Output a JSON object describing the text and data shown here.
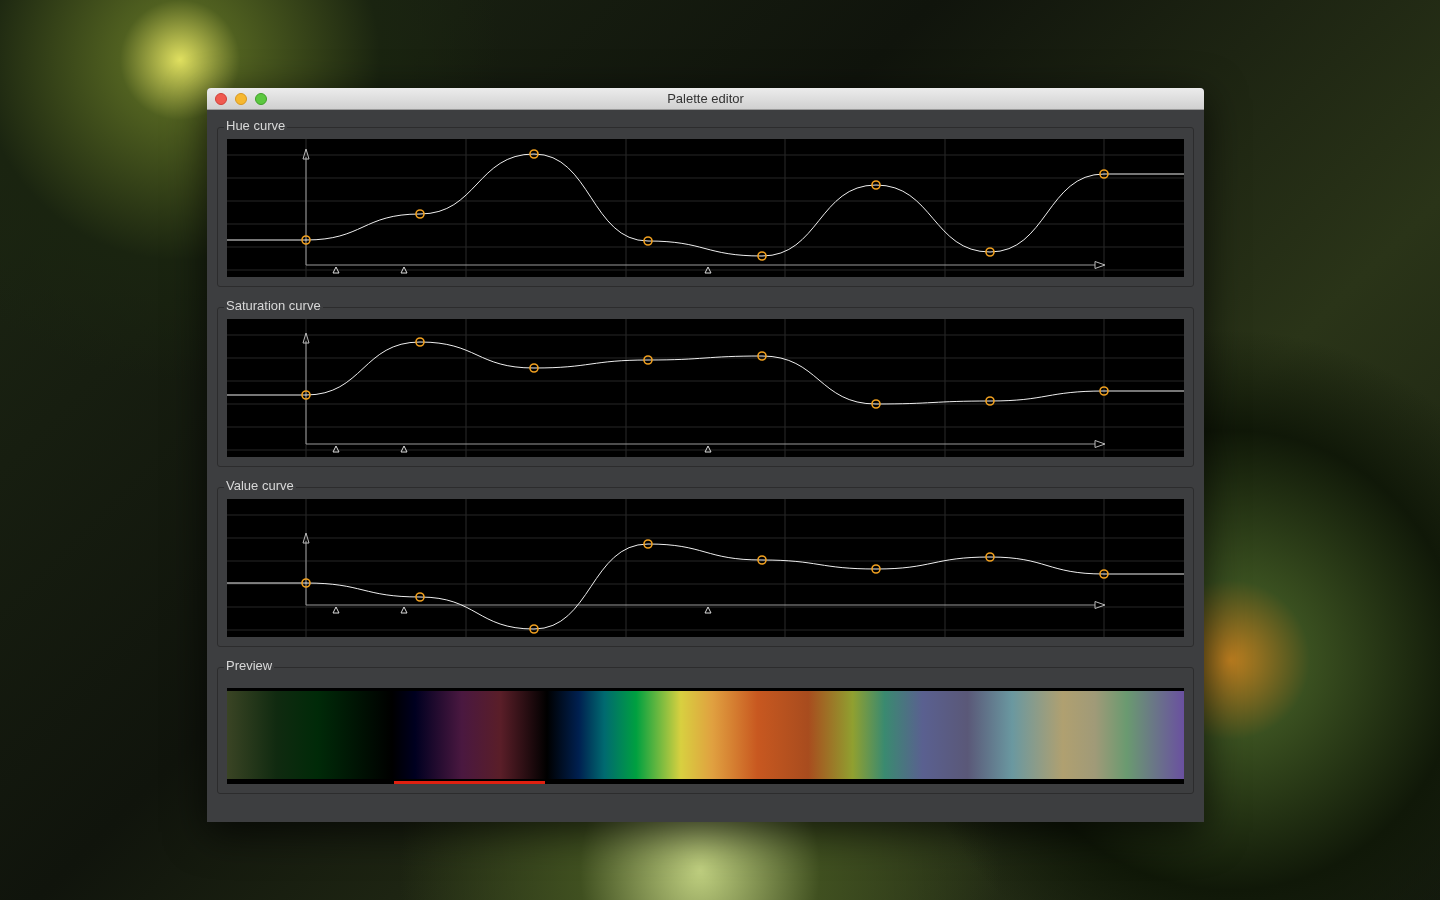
{
  "window": {
    "title": "Palette editor"
  },
  "curves": [
    {
      "title": "Hue curve"
    },
    {
      "title": "Saturation curve"
    },
    {
      "title": "Value curve"
    }
  ],
  "preview": {
    "title": "Preview",
    "segments": [
      {
        "selected": false
      },
      {
        "selected": true
      },
      {
        "selected": false
      }
    ]
  }
}
